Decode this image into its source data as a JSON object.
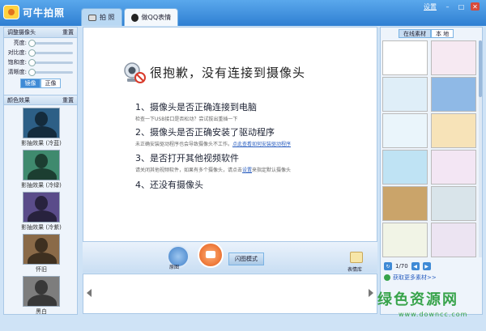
{
  "app": {
    "title": "可牛拍照",
    "settings": "设置"
  },
  "tabs": [
    {
      "label": "拍 照"
    },
    {
      "label": "做QQ表情"
    }
  ],
  "adjust": {
    "title": "调整摄像头",
    "reset": "重置",
    "sliders": [
      {
        "label": "亮度:",
        "value": 0
      },
      {
        "label": "对比度:",
        "value": 0
      },
      {
        "label": "饱和度:",
        "value": 0
      },
      {
        "label": "清晰度:",
        "value": 0
      }
    ],
    "mirror": {
      "on": "镜像",
      "off": "正像"
    }
  },
  "effects": {
    "title": "颜色效果",
    "reset": "重置",
    "items": [
      {
        "label": "影抽效果 (冷蓝)",
        "color": "#2d5f86"
      },
      {
        "label": "影抽效果 (冷绿)",
        "color": "#3f8a6e"
      },
      {
        "label": "影抽效果 (冷紫)",
        "color": "#5a4c8a"
      },
      {
        "label": "怀旧",
        "color": "#8a6a48"
      },
      {
        "label": "黑白",
        "color": "#7d7d7d"
      }
    ]
  },
  "main": {
    "error_title": "很抱歉，没有连接到摄像头",
    "items": [
      {
        "head": "1、摄像头是否正确连接到电脑",
        "desc": "检查一下USB接口是否松动？尝试拔出重插一下",
        "link": ""
      },
      {
        "head": "2、摄像头是否正确安装了驱动程序",
        "desc": "未正确安装驱动程序也会导致摄像头不工作。",
        "link": "点此查看如何安装驱动程序"
      },
      {
        "head": "3、是否打开其他视频软件",
        "desc": "请关闭其他视频软件，如果有多个摄像头，请点击",
        "link": "设置",
        "desc2": "来指定默认摄像头"
      },
      {
        "head": "4、还没有摄像头",
        "desc": "",
        "link": ""
      }
    ]
  },
  "toolbar": {
    "original": "原图",
    "flash": "闪图模式",
    "emoji": "表情库"
  },
  "right": {
    "tabs": [
      {
        "label": "在线素材"
      },
      {
        "label": "本 地"
      }
    ],
    "pager": "1/70",
    "more": "获取更多素材>>",
    "frames": [
      "#ffffff",
      "#f6e9f2",
      "#dfeef8",
      "#8fb9e6",
      "#eaf5fb",
      "#f7e3b8",
      "#bfe3f4",
      "#f3e6f4",
      "#caa46a",
      "#d9e4ea",
      "#f1f4e6",
      "#ece4f2"
    ]
  },
  "watermark": {
    "big": "绿色资源网",
    "small": "www.downcc.com"
  },
  "colors": {
    "accent": "#3f8ad6",
    "titlebar": "#2f7fd2",
    "capture": "#e45a17"
  }
}
